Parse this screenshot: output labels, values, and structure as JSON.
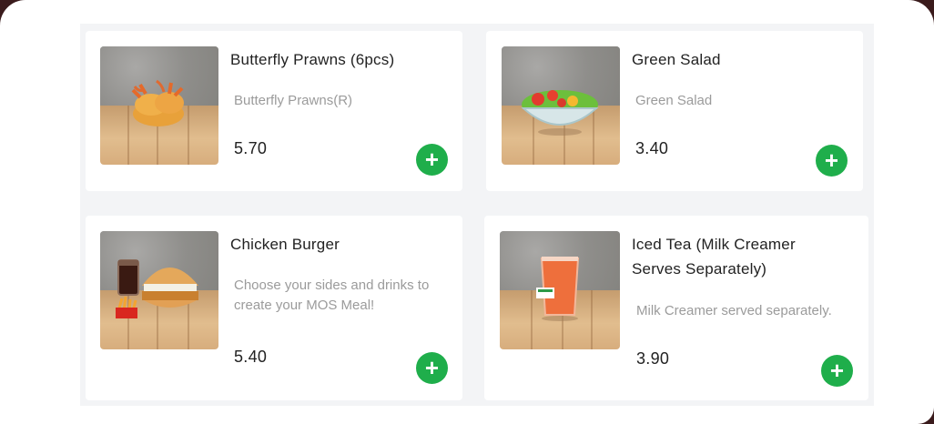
{
  "menu": {
    "items": [
      {
        "name": "Butterfly Prawns (6pcs)",
        "description": "Butterfly Prawns(R)",
        "price": "5.70",
        "add_icon": "plus-icon"
      },
      {
        "name": "Green Salad",
        "description": "Green Salad",
        "price": "3.40",
        "add_icon": "plus-icon"
      },
      {
        "name": "Chicken Burger",
        "description": "Choose your sides and drinks to create your MOS Meal!",
        "price": "5.40",
        "add_icon": "plus-icon"
      },
      {
        "name": "Iced Tea (Milk Creamer Serves Separately)",
        "description": "Milk Creamer served separately.",
        "price": "3.90",
        "add_icon": "plus-icon"
      }
    ]
  },
  "colors": {
    "accent_green": "#1fae4b",
    "page_border": "#3a1b1c",
    "price_text": "#222222",
    "description_text": "#9b9b9b"
  }
}
